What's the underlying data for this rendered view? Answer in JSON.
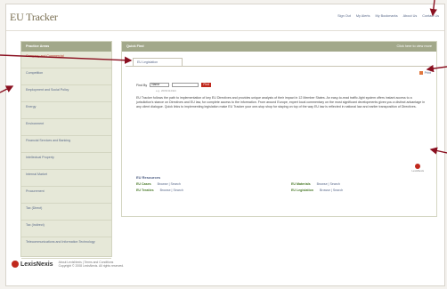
{
  "header": {
    "logo": "EU Tracker",
    "nav": [
      "Sign Out",
      "My Alerts",
      "My Bookmarks",
      "About Us",
      "Contact Us"
    ]
  },
  "sidebar": {
    "title": "Practice Areas",
    "items": [
      "Company and Commercial",
      "Competition",
      "Employment and Social Policy",
      "Energy",
      "Environment",
      "Financial Services and Banking",
      "Intellectual Property",
      "Internal Market",
      "Procurement",
      "Tax (Direct)",
      "Tax (Indirect)",
      "Telecommunications and Information Technology"
    ]
  },
  "main": {
    "title": "Quick Find",
    "header_link": "Click here to view more",
    "tab_label": "EU Legislation",
    "print_label": "Print",
    "search": {
      "find_by_label": "Find By",
      "select_value": "Name",
      "go_label": "Find",
      "hint": "e.g. 2006/112/EC"
    },
    "intro": "EU Tracker follows the path to implementation of key EU Directives and provides unique analysis of their impact in 12 Member States. An easy-to-read traffic-light system offers instant access to a jurisdiction's stance on Directives and EU law, for complete access to the information. From around Europe, expert local commentary on the most significant developments gives you a distinct advantage in any client dialogue. Quick links to implementing legislation make EU Tracker your one-stop shop for staying on top of the way EU law is reflected in national law and earlier transposition of Directives."
  },
  "lexis_badge": "LexisNexis",
  "resources": {
    "title": "EU Resources",
    "items": [
      {
        "label": "EU Cases",
        "links": "Browse | Search"
      },
      {
        "label": "EU Treaties",
        "links": "Browse | Search"
      },
      {
        "label": "EU Materials",
        "links": "Browse | Search"
      },
      {
        "label": "EU Legislation",
        "links": "Browse | Search"
      }
    ]
  },
  "footer": {
    "logo": "LexisNexis",
    "line1": "About LexisNexis | Terms and Conditions",
    "line2": "Copyright © 2008 LexisNexis. All rights reserved."
  },
  "colors": {
    "accent": "#c0281c",
    "panel_header": "#a2a88a",
    "sidebar_bg": "#e6e8d8",
    "link": "#5a6a8a"
  }
}
